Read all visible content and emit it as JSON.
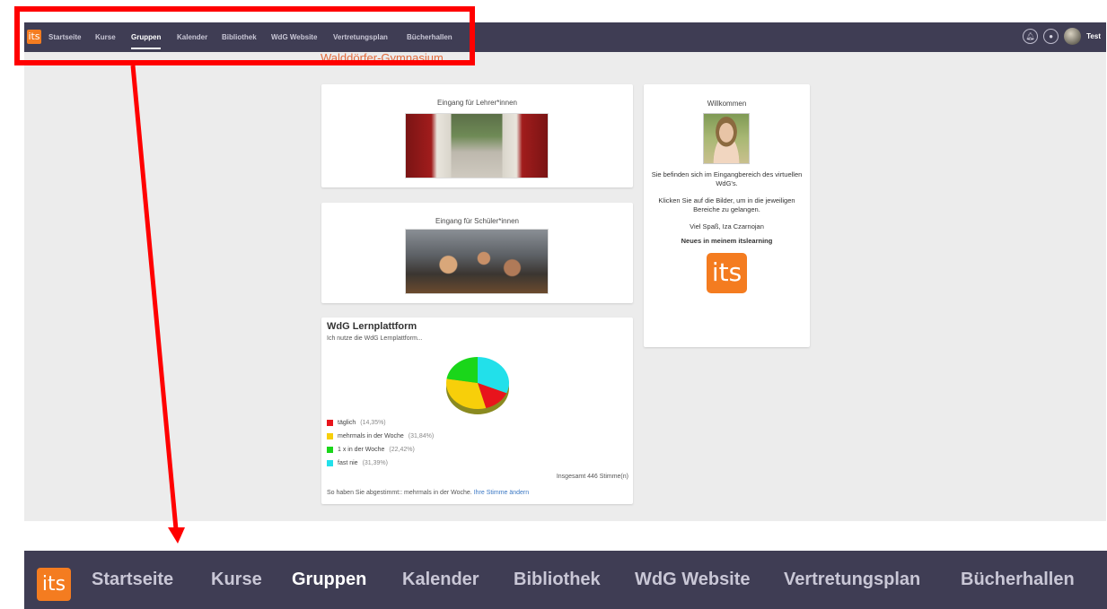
{
  "brand": {
    "logo_text": "its",
    "accent": "#f47c20",
    "topbar_color": "#3f3d54",
    "annotation_color": "#ff0000"
  },
  "nav": {
    "items": [
      {
        "label": "Startseite",
        "active": false
      },
      {
        "label": "Kurse",
        "active": false
      },
      {
        "label": "Gruppen",
        "active": true
      },
      {
        "label": "Kalender",
        "active": false
      },
      {
        "label": "Bibliothek",
        "active": false
      },
      {
        "label": "WdG Website",
        "active": false
      },
      {
        "label": "Vertretungsplan",
        "active": false
      },
      {
        "label": "Bücherhallen",
        "active": false
      }
    ]
  },
  "topbar_right": {
    "notifications_icon": "bell-icon",
    "messages_icon": "chat-bubble-icon",
    "user_name": "Test"
  },
  "page": {
    "school_title": "Walddörfer-Gymnasium",
    "lehrer_card": {
      "caption": "Eingang für Lehrer*innen"
    },
    "schueler_card": {
      "caption": "Eingang für Schüler*innen"
    },
    "poll": {
      "title": "WdG Lernplattform",
      "question": "Ich nutze die WdG Lernplattform...",
      "options": [
        {
          "label": "täglich",
          "percent": "(14,35%)",
          "color": "#e8141c"
        },
        {
          "label": "mehrmals in der Woche",
          "percent": "(31,84%)",
          "color": "#f7cf0a"
        },
        {
          "label": "1 x in der Woche",
          "percent": "(22,42%)",
          "color": "#1ad61a"
        },
        {
          "label": "fast nie",
          "percent": "(31,39%)",
          "color": "#22e0ea"
        }
      ],
      "total": "Insgesamt 446 Stimme(n)",
      "voted_text": "So haben Sie abgestimmt:: mehrmals in der Woche.",
      "change_link": "Ihre Stimme ändern"
    },
    "welcome": {
      "title": "Willkommen",
      "line1": "Sie befinden sich im Eingangbereich des virtuellen WdG's.",
      "line2": "Klicken Sie auf die Bilder, um in die jeweiligen Bereiche zu gelangen.",
      "line3": "Viel Spaß, Iza Czarnojan",
      "line4": "Neues in meinem itslearning",
      "logo_text": "its"
    }
  },
  "chart_data": {
    "type": "pie",
    "categories": [
      "täglich",
      "mehrmals in der Woche",
      "1 x in der Woche",
      "fast nie"
    ],
    "values": [
      14.35,
      31.84,
      22.42,
      31.39
    ],
    "colors": [
      "#e8141c",
      "#f7cf0a",
      "#1ad61a",
      "#22e0ea"
    ],
    "title": "WdG Lernplattform"
  }
}
